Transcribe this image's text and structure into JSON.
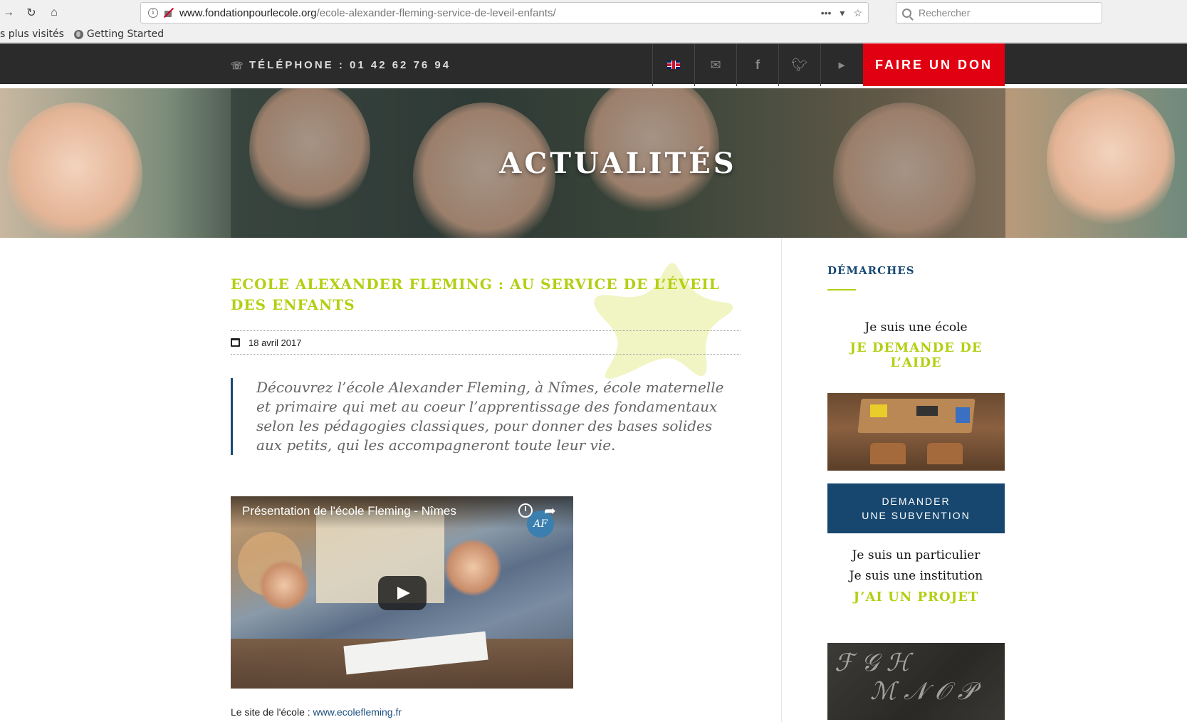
{
  "browser": {
    "url_domain": "www.fondationpourlecole.org",
    "url_path": "/ecole-alexander-fleming-service-de-leveil-enfants/",
    "search_placeholder": "Rechercher",
    "bookmarks": [
      "s plus visités",
      "Getting Started"
    ]
  },
  "topbar": {
    "phone_label": "TÉLÉPHONE : 01 42 62 76 94",
    "icons": [
      "uk-flag-icon",
      "mail-icon",
      "facebook-icon",
      "twitter-icon",
      "youtube-icon"
    ],
    "donate_label": "FAIRE UN DON"
  },
  "hero": {
    "title": "ACTUALITÉS"
  },
  "post": {
    "title": "ECOLE ALEXANDER FLEMING : AU SERVICE DE L’ÉVEIL DES ENFANTS",
    "date": "18 avril 2017",
    "intro": "Découvrez l’école Alexander Fleming, à Nîmes, école maternelle et primaire qui met au coeur l’apprentissage des fondamentaux selon les pédagogies classiques, pour donner des bases solides aux petits, qui les accompagneront toute leur vie.",
    "video_title": "Présentation de l'école Fleming - Nîmes",
    "video_logo": "AF",
    "site_label": "Le site de l'école : ",
    "site_link": "www.ecolefleming.fr"
  },
  "sidebar": {
    "title": "DÉMARCHES",
    "school_text": "Je suis une école",
    "school_cta": "JE DEMANDE DE L’AIDE",
    "subsidy_line1": "DEMANDER",
    "subsidy_line2": "UNE SUBVENTION",
    "individual_text": "Je suis un particulier",
    "institution_text": "Je suis une institution",
    "project_cta": "J’AI UN PROJET"
  },
  "colors": {
    "accent_green": "#b4cf12",
    "brand_blue": "#17476f",
    "donate_red": "#e10012",
    "topbar_dark": "#2b2b2b"
  }
}
